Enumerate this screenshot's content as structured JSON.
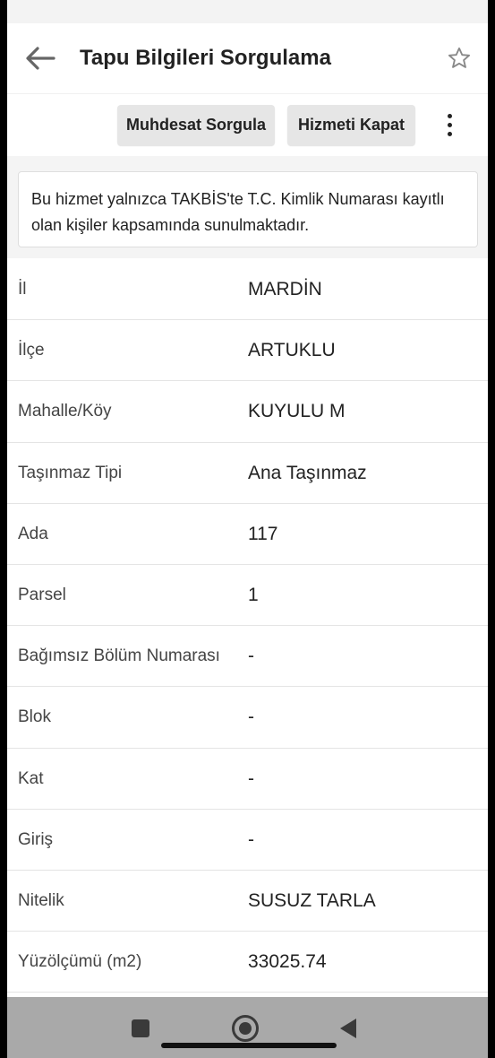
{
  "app": {
    "title": "Tapu Bilgileri Sorgulama",
    "icons": {
      "back": "arrow-left-icon",
      "favorite": "star-outline-icon",
      "more": "more-vertical-icon"
    }
  },
  "actions": {
    "muhdesat_label": "Muhdesat Sorgula",
    "kapat_label": "Hizmeti Kapat"
  },
  "notice": {
    "text": "Bu hizmet yalnızca TAKBİS'te T.C. Kimlik Numarası kayıtlı olan kişiler kapsamında sunulmaktadır."
  },
  "details": [
    {
      "label": "İl",
      "value": "MARDİN"
    },
    {
      "label": "İlçe",
      "value": "ARTUKLU"
    },
    {
      "label": "Mahalle/Köy",
      "value": "KUYULU M"
    },
    {
      "label": "Taşınmaz Tipi",
      "value": "Ana Taşınmaz"
    },
    {
      "label": "Ada",
      "value": "117"
    },
    {
      "label": "Parsel",
      "value": "1"
    },
    {
      "label": "Bağımsız Bölüm Numarası",
      "value": "-"
    },
    {
      "label": "Blok",
      "value": "-"
    },
    {
      "label": "Kat",
      "value": "-"
    },
    {
      "label": "Giriş",
      "value": "-"
    },
    {
      "label": "Nitelik",
      "value": "SUSUZ TARLA"
    },
    {
      "label": "Yüzölçümü (m2)",
      "value": "33025.74"
    }
  ],
  "colors": {
    "chip_background": "#e6e6e6",
    "nav_bar": "#a9a9a9",
    "divider": "#e4e4e4"
  }
}
